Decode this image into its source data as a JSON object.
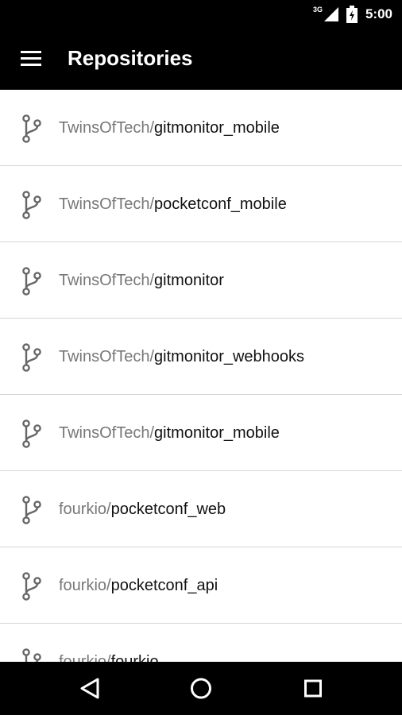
{
  "status_bar": {
    "network_label": "3G",
    "time": "5:00",
    "icons": [
      "signal-icon",
      "battery-icon"
    ]
  },
  "app_bar": {
    "menu_icon": "menu-icon",
    "title": "Repositories"
  },
  "repositories": [
    {
      "owner": "TwinsOfTech/",
      "name": "gitmonitor_mobile"
    },
    {
      "owner": "TwinsOfTech/",
      "name": "pocketconf_mobile"
    },
    {
      "owner": "TwinsOfTech/",
      "name": "gitmonitor"
    },
    {
      "owner": "TwinsOfTech/",
      "name": "gitmonitor_webhooks"
    },
    {
      "owner": "TwinsOfTech/",
      "name": "gitmonitor_mobile"
    },
    {
      "owner": "fourkio/",
      "name": "pocketconf_web"
    },
    {
      "owner": "fourkio/",
      "name": "pocketconf_api"
    },
    {
      "owner": "fourkio/",
      "name": "fourkio"
    }
  ],
  "nav_bar": {
    "icons": [
      "back-icon",
      "home-icon",
      "recents-icon"
    ]
  },
  "colors": {
    "bars": "#000000",
    "owner_text": "#777777",
    "repo_text": "#111111",
    "divider": "#d6d6d6"
  }
}
